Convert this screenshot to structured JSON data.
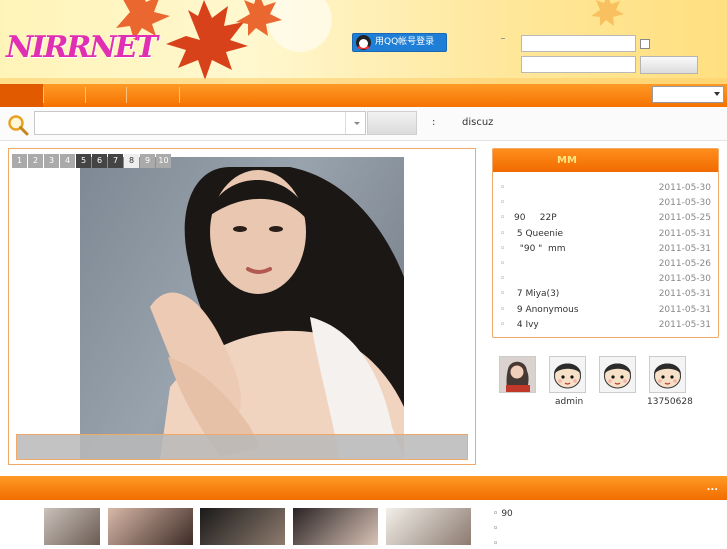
{
  "header": {
    "logo_text": "NIRRNET",
    "qq_login_label": "用QQ帐号登录",
    "username_value": "",
    "password_value": ""
  },
  "search": {
    "placeholder": "",
    "hot_label": ":",
    "hot_keyword": "discuz"
  },
  "slideshow": {
    "pages": [
      "1",
      "2",
      "3",
      "4",
      "5",
      "6",
      "7",
      "8",
      "9",
      "10"
    ],
    "current_page": "8",
    "caption": ""
  },
  "mm_panel": {
    "title": "MM",
    "items": [
      {
        "title": "",
        "date": "2011-05-30"
      },
      {
        "title": "",
        "date": "2011-05-30"
      },
      {
        "title": "90     22P",
        "date": "2011-05-25"
      },
      {
        "title": " 5 Queenie",
        "date": "2011-05-31"
      },
      {
        "title": "  \"90 \"  mm",
        "date": "2011-05-31"
      },
      {
        "title": "",
        "date": "2011-05-26"
      },
      {
        "title": "",
        "date": "2011-05-30"
      },
      {
        "title": " 7 Miya(3)",
        "date": "2011-05-31"
      },
      {
        "title": " 9 Anonymous",
        "date": "2011-05-31"
      },
      {
        "title": " 4 Ivy",
        "date": "2011-05-31"
      }
    ]
  },
  "members": [
    {
      "name": ""
    },
    {
      "name": "admin"
    },
    {
      "name": ""
    },
    {
      "name": "13750628"
    }
  ],
  "bottom": {
    "more_label": "...",
    "list": [
      {
        "bullet": "◦",
        "text": "90"
      },
      {
        "bullet": "◦",
        "text": ""
      },
      {
        "bullet": "◦",
        "text": ""
      }
    ]
  },
  "colors": {
    "accent_orange": "#f57200",
    "panel_border": "#f0a968",
    "logo_pink": "#e02fb2",
    "qq_blue": "#1f7fd6"
  },
  "icons": [
    "maple-leaf-icon",
    "qq-penguin-icon",
    "search-magnifier-icon",
    "chevron-down-icon",
    "default-avatar-icon"
  ]
}
